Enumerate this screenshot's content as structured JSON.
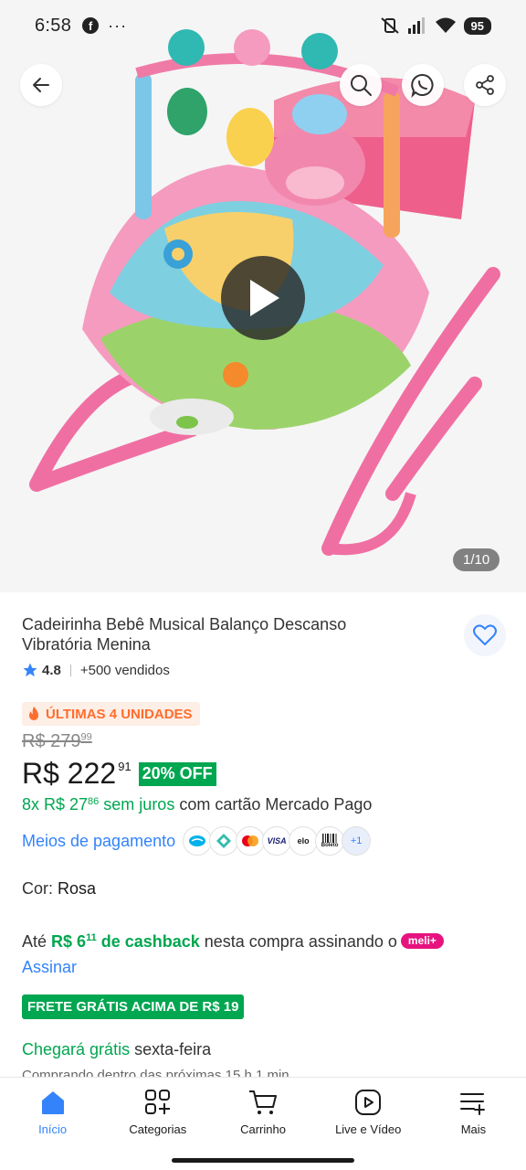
{
  "status_bar": {
    "time": "6:58",
    "app_icon": "facebook-icon",
    "more_indicator": "···",
    "battery": "95"
  },
  "gallery": {
    "counter": "1/10",
    "actions": [
      "back-icon",
      "search-icon",
      "whatsapp-icon",
      "share-icon"
    ],
    "play_icon": "play-icon"
  },
  "product": {
    "title": "Cadeirinha Bebê Musical Balanço Descanso Vibratória Menina",
    "rating": "4.8",
    "sold": "+500 vendidos",
    "urgency": "ÚLTIMAS 4 UNIDADES",
    "old_price_main": "R$ 279",
    "old_price_cents": "99",
    "price_main": "R$ 222",
    "price_cents": "91",
    "discount": "20% OFF",
    "installments_prefix": "8x R$ 27",
    "installments_cents": "86",
    "installments_interest": " sem juros",
    "installments_suffix": " com cartão Mercado Pago",
    "payment_link": "Meios de pagamento",
    "payment_methods": [
      "VISA",
      "elo",
      "Boleto",
      "+1"
    ],
    "color_label": "Cor: ",
    "color_value": "Rosa",
    "cashback_prefix": "Até ",
    "cashback_amount": "R$ 6",
    "cashback_cents": "11",
    "cashback_label": " de cashback",
    "cashback_suffix": " nesta compra assinando o",
    "meli_badge": "meli+",
    "subscribe": "Assinar",
    "free_shipping": "FRETE GRÁTIS ACIMA DE R$ 19",
    "delivery_green": "Chegará grátis",
    "delivery_day": " sexta-feira",
    "delivery_sub": "Comprando dentro das próximas 15 h 1 min"
  },
  "nav": {
    "items": [
      {
        "label": "Início",
        "icon": "home-icon",
        "active": true
      },
      {
        "label": "Categorias",
        "icon": "categories-icon"
      },
      {
        "label": "Carrinho",
        "icon": "cart-icon"
      },
      {
        "label": "Live e Vídeo",
        "icon": "video-icon"
      },
      {
        "label": "Mais",
        "icon": "menu-icon"
      }
    ]
  },
  "colors": {
    "accent_blue": "#3483fa",
    "green": "#00a650",
    "urgency_orange": "#ff6d2d",
    "meli_pink": "#e6137f"
  }
}
